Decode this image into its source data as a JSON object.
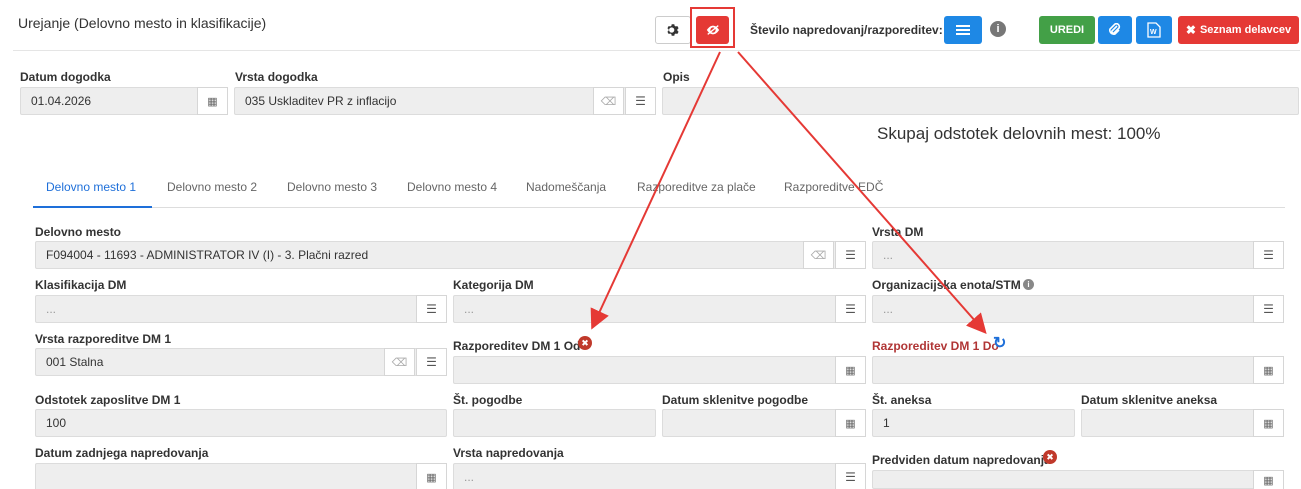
{
  "header": {
    "title": "Urejanje (Delovno mesto in klasifikacije)",
    "advance_count_label": "Število napredovanj/razporeditev: 0",
    "edit_label": "UREDI",
    "employee_list_label": "Seznam delavcev"
  },
  "event": {
    "date_label": "Datum dogodka",
    "date_value": "01.04.2026",
    "type_label": "Vrsta dogodka",
    "type_value": "035 Uskladitev PR z inflacijo",
    "desc_label": "Opis",
    "desc_value": ""
  },
  "summary": "Skupaj odstotek delovnih mest: 100%",
  "tabs": [
    {
      "label": "Delovno mesto 1",
      "active": true
    },
    {
      "label": "Delovno mesto 2"
    },
    {
      "label": "Delovno mesto 3"
    },
    {
      "label": "Delovno mesto 4"
    },
    {
      "label": "Nadomeščanja"
    },
    {
      "label": "Razporeditve za plače"
    },
    {
      "label": "Razporeditve EDČ"
    }
  ],
  "form": {
    "workplace_label": "Delovno mesto",
    "workplace_value": "F094004 - 11693 - ADMINISTRATOR IV (I) - 3. Plačni razred",
    "wp_type_label": "Vrsta DM",
    "classification_label": "Klasifikacija DM",
    "category_label": "Kategorija DM",
    "org_unit_label": "Organizacijska enota/STM",
    "assign_type_label": "Vrsta razporeditve DM 1",
    "assign_type_value": "001 Stalna",
    "assign_from_label": "Razporeditev DM 1 Od",
    "assign_to_label": "Razporeditev DM 1 Do",
    "employ_pct_label": "Odstotek zaposlitve DM 1",
    "employ_pct_value": "100",
    "contract_no_label": "Št. pogodbe",
    "contract_date_label": "Datum sklenitve pogodbe",
    "annex_no_label": "Št. aneksa",
    "annex_no_value": "1",
    "annex_date_label": "Datum sklenitve aneksa",
    "last_adv_label": "Datum zadnjega napredovanja",
    "adv_type_label": "Vrsta napredovanja",
    "planned_adv_label": "Predviden datum napredovanja",
    "placeholder": "..."
  },
  "colors": {
    "primary": "#1e88e5",
    "danger": "#e53935",
    "success": "#43a047",
    "tab_active": "#1e6fd9",
    "required_label": "#b03535"
  }
}
